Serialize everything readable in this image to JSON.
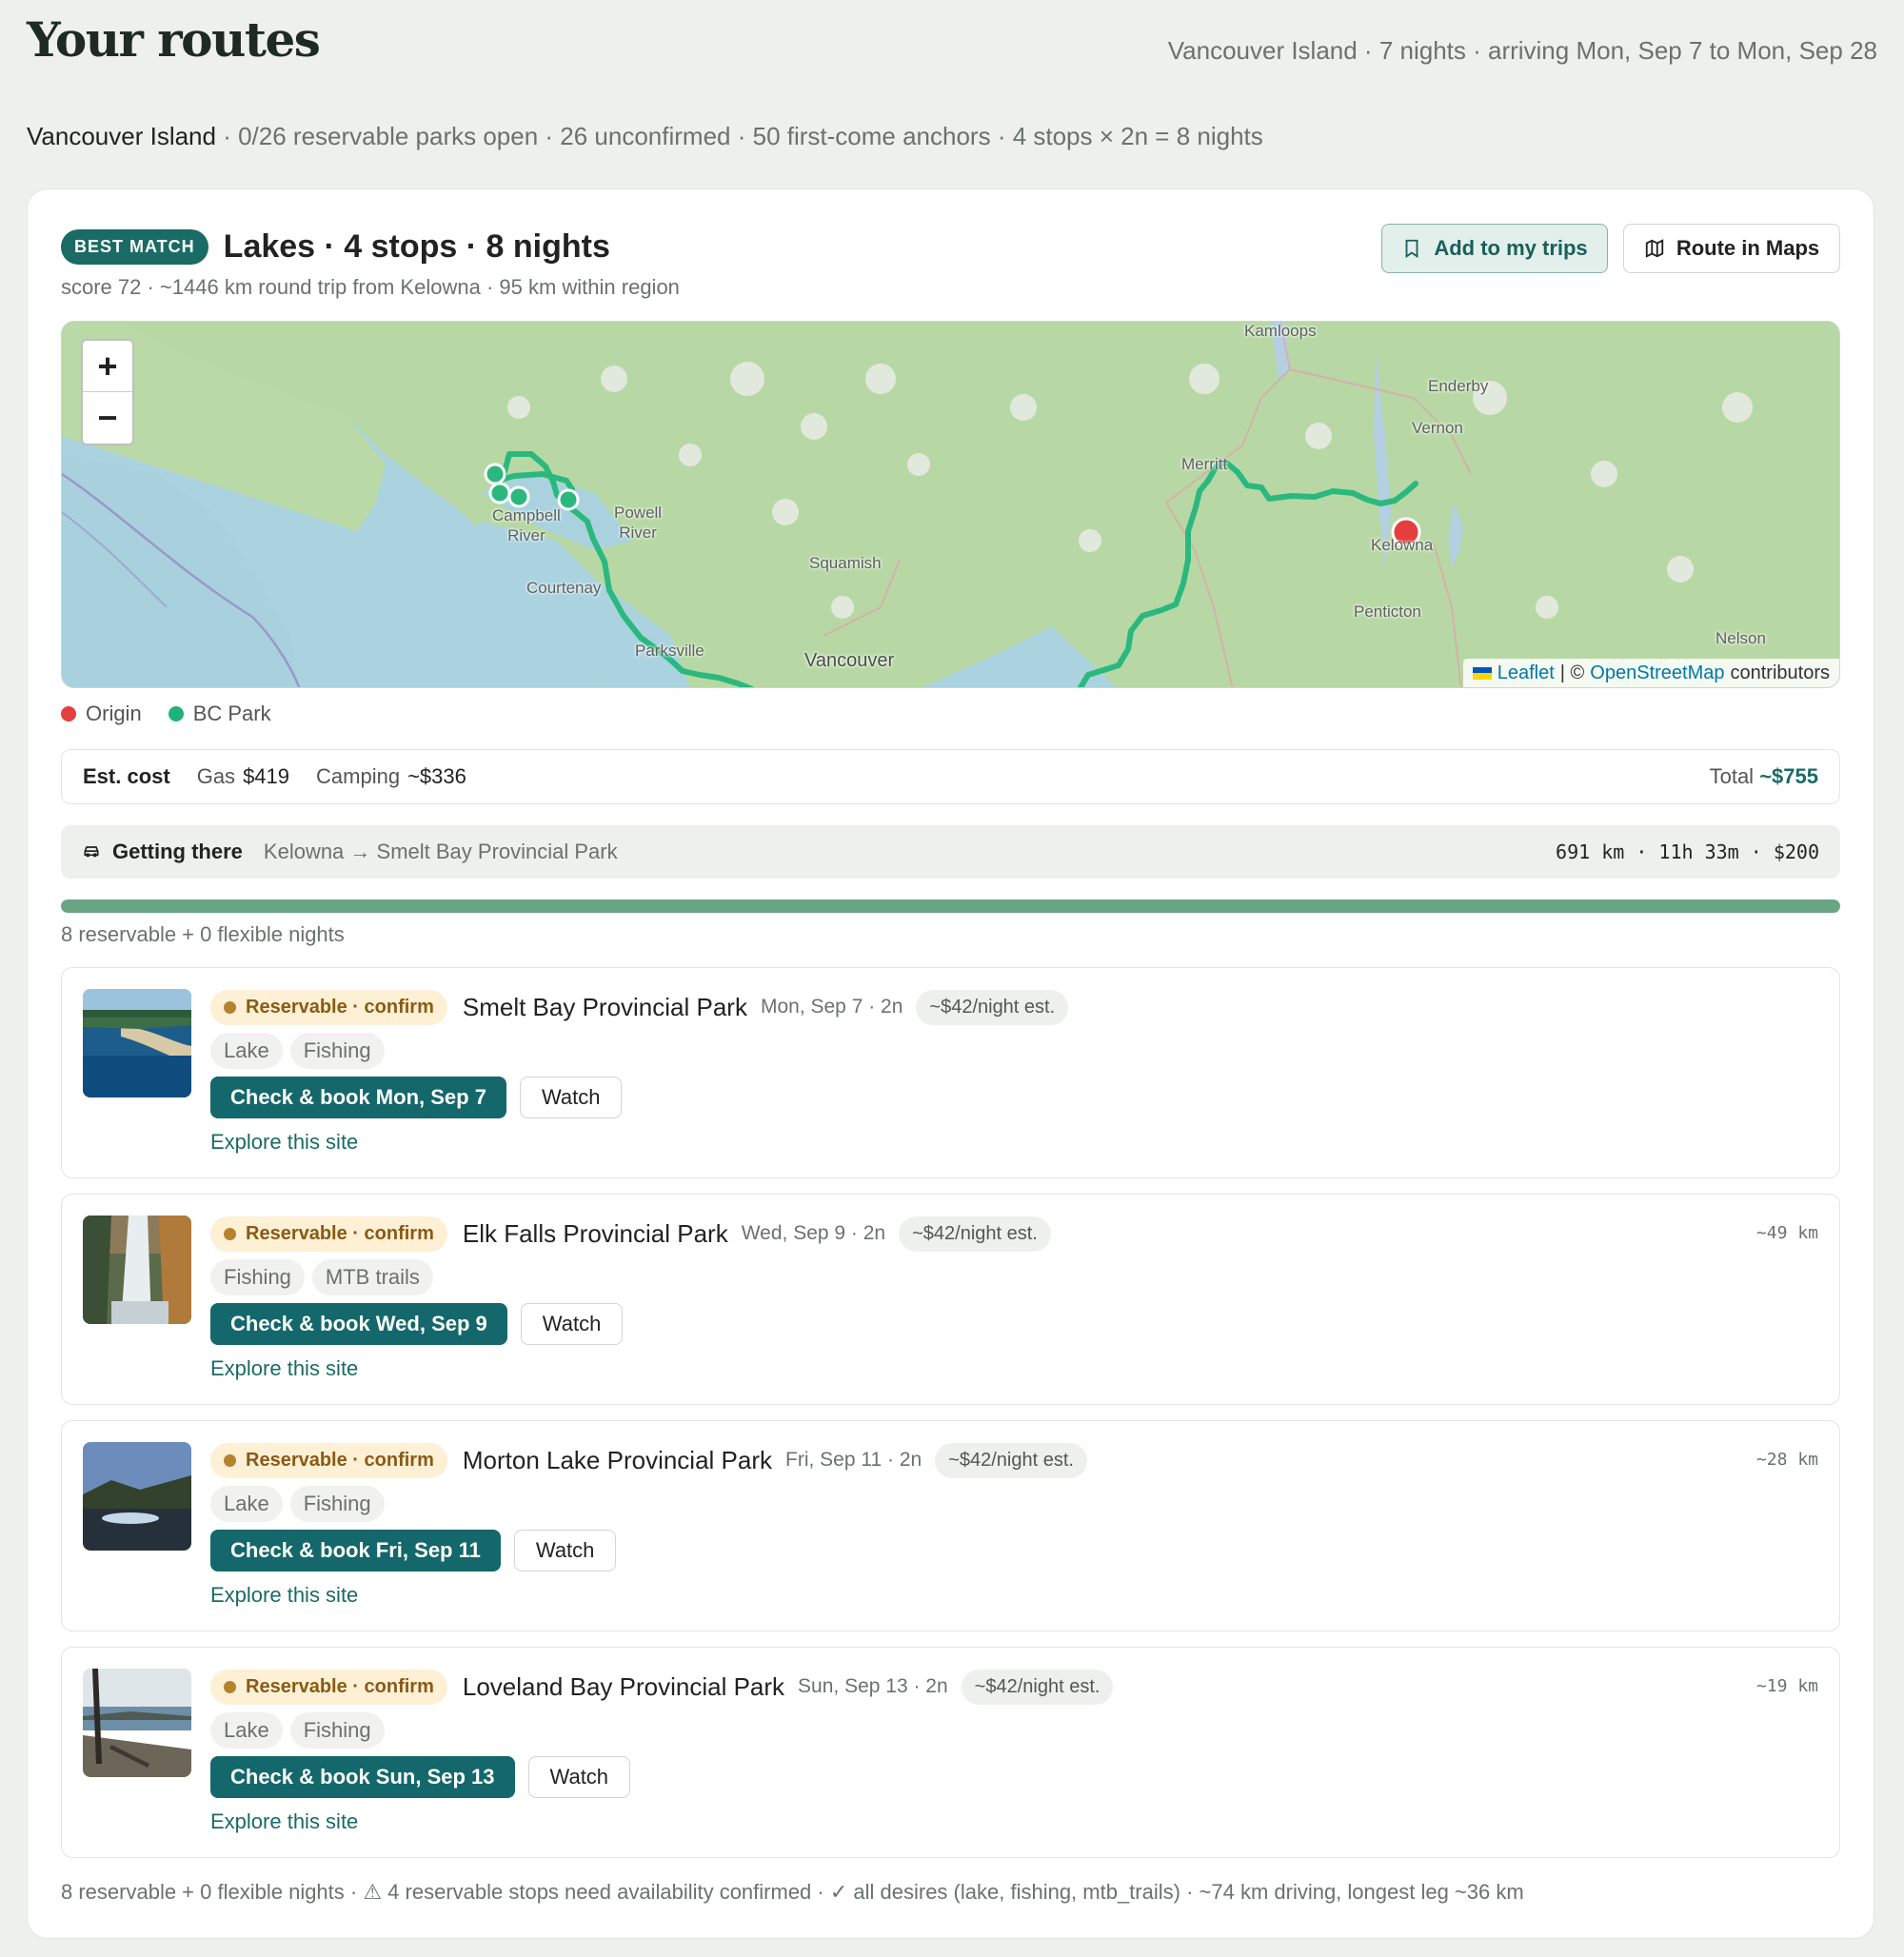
{
  "page": {
    "title": "Your routes",
    "subtitle": "Vancouver Island · 7 nights · arriving Mon, Sep 7 to Mon, Sep 28",
    "summary_region": "Vancouver Island",
    "summary_rest": " · 0/26 reservable parks open · 26 unconfirmed · 50 first-come anchors · 4 stops × 2n = 8 nights"
  },
  "route": {
    "badge": "BEST MATCH",
    "title": "Lakes · 4 stops · 8 nights",
    "meta": "score 72 · ~1446 km round trip from Kelowna · 95 km within region",
    "add_label": "Add to my trips",
    "maps_label": "Route in Maps",
    "add_icon": "bookmark-icon",
    "maps_icon": "map-icon"
  },
  "map": {
    "zoom_in": "+",
    "zoom_out": "−",
    "labels": {
      "kamloops": "Kamloops",
      "enderby": "Enderby",
      "vernon": "Vernon",
      "merritt": "Merritt",
      "kelowna": "Kelowna",
      "penticton": "Penticton",
      "nelson": "Nelson",
      "squamish": "Squamish",
      "vancouver": "Vancouver",
      "powell_river": "Powell\nRiver",
      "campbell_river": "Campbell\nRiver",
      "courtenay": "Courtenay",
      "parksville": "Parksville"
    },
    "attribution_leaflet": "Leaflet",
    "attribution_sep": "| ©",
    "attribution_osm": "OpenStreetMap",
    "attribution_rest": "contributors",
    "route_color": "#2bb87e",
    "origin_color": "#e53e3e"
  },
  "legend": {
    "origin": "Origin",
    "park": "BC Park"
  },
  "cost": {
    "label": "Est. cost",
    "gas_label": "Gas",
    "gas_value": "$419",
    "camping_label": "Camping",
    "camping_value": "~$336",
    "total_label": "Total",
    "total_value": "~$755"
  },
  "getting_there": {
    "icon": "car-icon",
    "label": "Getting there",
    "path": "Kelowna → Smelt Bay Provincial Park",
    "stats": "691 km · 11h 33m · $200"
  },
  "progress": {
    "reservable_fraction": 1.0
  },
  "nights_note": "8 reservable + 0 flexible nights",
  "stops": [
    {
      "status": "Reservable · confirm",
      "name": "Smelt Bay Provincial Park",
      "date": "Mon, Sep 7 · 2n",
      "price": "~$42/night est.",
      "distance": "",
      "tags": [
        "Lake",
        "Fishing"
      ],
      "book": "Check & book Mon, Sep 7",
      "watch": "Watch",
      "explore": "Explore this site",
      "thumb": "beach-photo"
    },
    {
      "status": "Reservable · confirm",
      "name": "Elk Falls Provincial Park",
      "date": "Wed, Sep 9 · 2n",
      "price": "~$42/night est.",
      "distance": "~49 km",
      "tags": [
        "Fishing",
        "MTB trails"
      ],
      "book": "Check & book Wed, Sep 9",
      "watch": "Watch",
      "explore": "Explore this site",
      "thumb": "waterfall-photo"
    },
    {
      "status": "Reservable · confirm",
      "name": "Morton Lake Provincial Park",
      "date": "Fri, Sep 11 · 2n",
      "price": "~$42/night est.",
      "distance": "~28 km",
      "tags": [
        "Lake",
        "Fishing"
      ],
      "book": "Check & book Fri, Sep 11",
      "watch": "Watch",
      "explore": "Explore this site",
      "thumb": "lake-photo"
    },
    {
      "status": "Reservable · confirm",
      "name": "Loveland Bay Provincial Park",
      "date": "Sun, Sep 13 · 2n",
      "price": "~$42/night est.",
      "distance": "~19 km",
      "tags": [
        "Lake",
        "Fishing"
      ],
      "book": "Check & book Sun, Sep 13",
      "watch": "Watch",
      "explore": "Explore this site",
      "thumb": "shoreline-photo"
    }
  ],
  "footer": "8 reservable + 0 flexible nights · ⚠ 4 reservable stops need availability confirmed · ✓ all desires (lake, fishing, mtb_trails) · ~74 km driving, longest leg ~36 km"
}
